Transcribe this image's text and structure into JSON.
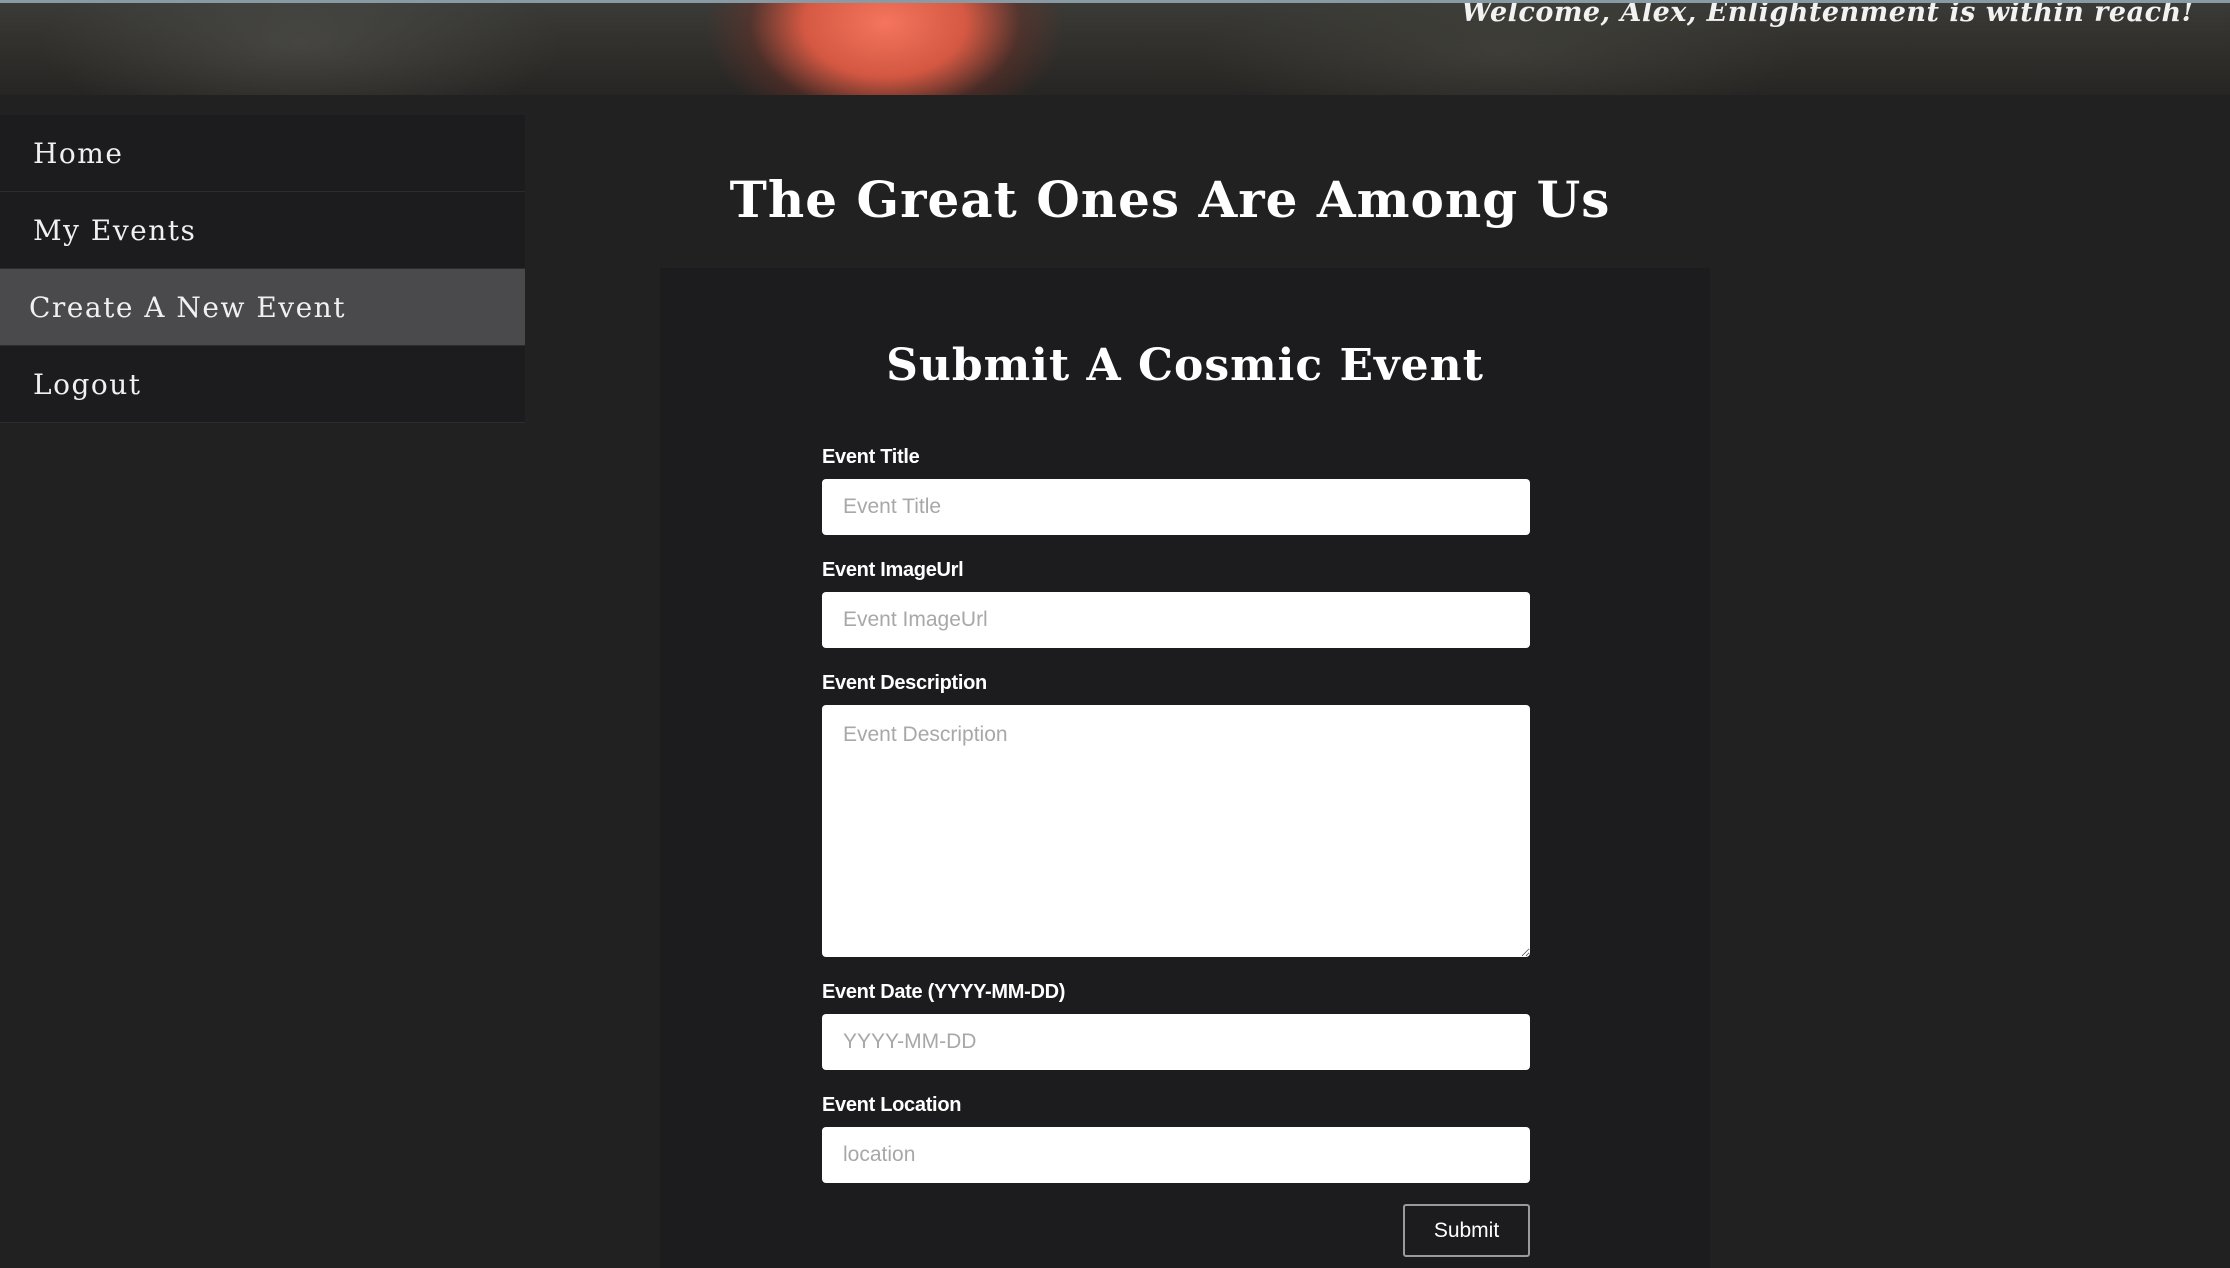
{
  "header": {
    "welcome_text": "Welcome, Alex, Enlightenment is within reach!"
  },
  "sidebar": {
    "items": [
      {
        "label": "Home"
      },
      {
        "label": "My Events"
      },
      {
        "label": "Create A New Event"
      },
      {
        "label": "Logout"
      }
    ]
  },
  "main": {
    "page_title": "The Great Ones Are Among Us"
  },
  "form": {
    "title": "Submit A Cosmic Event",
    "fields": {
      "title": {
        "label": "Event Title",
        "placeholder": "Event Title",
        "value": ""
      },
      "image_url": {
        "label": "Event ImageUrl",
        "placeholder": "Event ImageUrl",
        "value": ""
      },
      "description": {
        "label": "Event Description",
        "placeholder": "Event Description",
        "value": ""
      },
      "date": {
        "label": "Event Date (YYYY-MM-DD)",
        "placeholder": "YYYY-MM-DD",
        "value": ""
      },
      "location": {
        "label": "Event Location",
        "placeholder": "location",
        "value": ""
      }
    },
    "submit_label": "Submit"
  },
  "colors": {
    "page_background": "#212121",
    "panel_background": "#1c1c1e",
    "active_nav_background": "#4a4a4c",
    "text": "#ffffff",
    "banner_glow": "#f0654f"
  }
}
